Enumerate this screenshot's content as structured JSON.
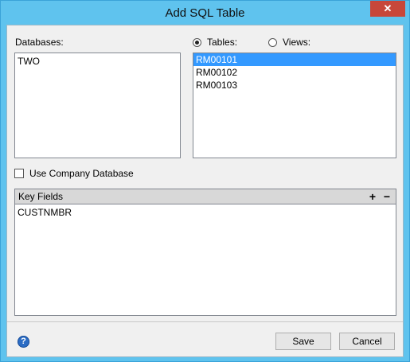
{
  "window": {
    "title": "Add SQL Table",
    "close_glyph": "✕"
  },
  "databases": {
    "label": "Databases:",
    "items": [
      "TWO"
    ]
  },
  "source_type": {
    "tables_label": "Tables:",
    "views_label": "Views:",
    "selected": "Tables"
  },
  "tables": {
    "items": [
      "RM00101",
      "RM00102",
      "RM00103"
    ],
    "selected_index": 0
  },
  "use_company_database": {
    "label": "Use Company Database",
    "checked": false
  },
  "key_fields": {
    "header": "Key Fields",
    "add_glyph": "+",
    "remove_glyph": "−",
    "items": [
      "CUSTNMBR"
    ]
  },
  "footer": {
    "help_glyph": "?",
    "save_label": "Save",
    "cancel_label": "Cancel"
  },
  "colors": {
    "titlebar": "#5fc3ee",
    "close": "#c7473a",
    "selection": "#3399ff"
  }
}
